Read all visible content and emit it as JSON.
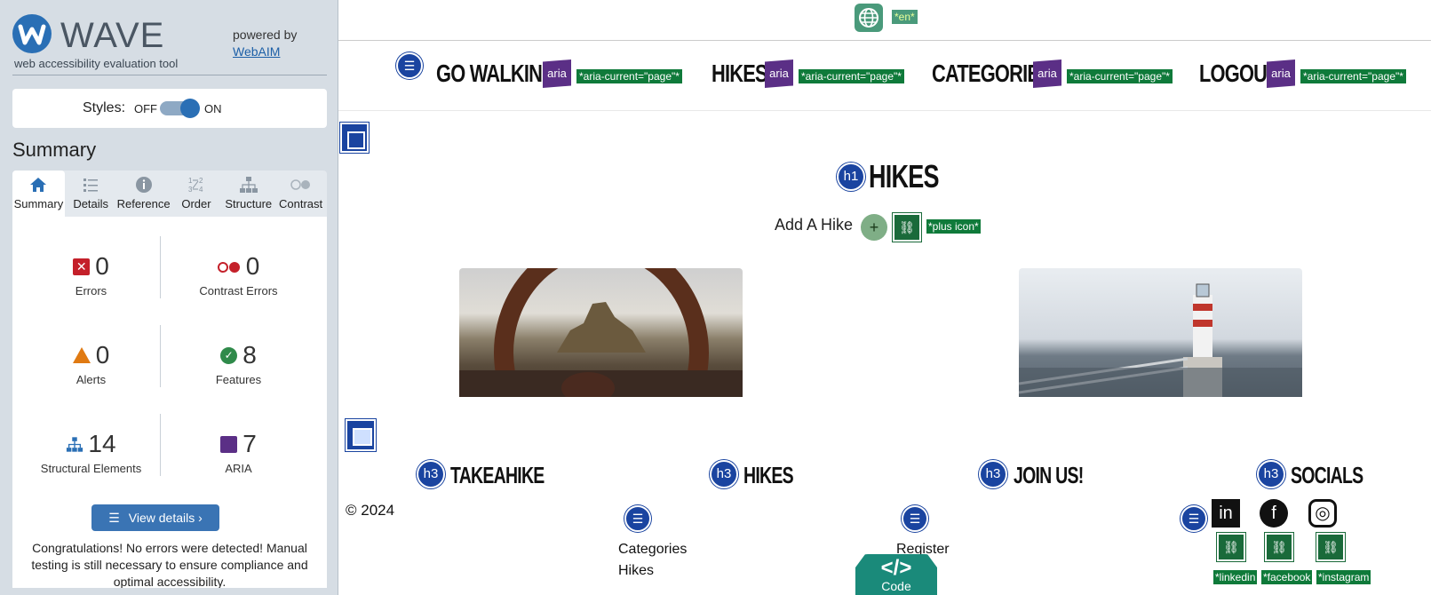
{
  "wave": {
    "logo_text": "WAVE",
    "tagline": "web accessibility evaluation tool",
    "powered_by": "powered by",
    "webaim_link": "WebAIM",
    "styles_label": "Styles:",
    "off_label": "OFF",
    "on_label": "ON",
    "summary_heading": "Summary",
    "tabs": [
      {
        "label": "Summary",
        "icon": "home-icon",
        "active": true
      },
      {
        "label": "Details",
        "icon": "list-icon",
        "active": false
      },
      {
        "label": "Reference",
        "icon": "info-icon",
        "active": false
      },
      {
        "label": "Order",
        "icon": "order-icon",
        "active": false
      },
      {
        "label": "Structure",
        "icon": "structure-icon",
        "active": false
      },
      {
        "label": "Contrast",
        "icon": "contrast-icon",
        "active": false
      }
    ],
    "stats": {
      "errors": {
        "value": "0",
        "label": "Errors"
      },
      "contrast_errors": {
        "value": "0",
        "label": "Contrast Errors"
      },
      "alerts": {
        "value": "0",
        "label": "Alerts"
      },
      "features": {
        "value": "8",
        "label": "Features"
      },
      "structural": {
        "value": "14",
        "label": "Structural Elements"
      },
      "aria": {
        "value": "7",
        "label": "ARIA"
      }
    },
    "view_details": "View details ›",
    "congrats": "Congratulations! No errors were detected! Manual testing is still necessary to ensure compliance and optimal accessibility."
  },
  "page": {
    "lang_tag": "*en*",
    "nav": [
      {
        "label": "GO WALKING!",
        "aria_tag": "*aria-current=\"page\"*"
      },
      {
        "label": "HIKES",
        "aria_tag": "*aria-current=\"page\"*"
      },
      {
        "label": "CATEGORIES",
        "aria_tag": "*aria-current=\"page\"*"
      },
      {
        "label": "LOGOUT",
        "aria_tag": "*aria-current=\"page\"*"
      }
    ],
    "aria_icon_text": "aria",
    "h1_icon": "h1",
    "h1": "HIKES",
    "add_hike": "Add A Hike",
    "plus": "+",
    "plus_icon_alt": "*plus icon*",
    "footer": {
      "h3_icon": "h3",
      "col1_heading": "TAKEAHIKE",
      "col2_heading": "HIKES",
      "col3_heading": "JOIN US!",
      "col4_heading": "SOCIALS",
      "copyright": "© 2024",
      "links_col2": [
        "Categories",
        "Hikes"
      ],
      "links_col3": [
        "Register"
      ],
      "social_alts": [
        "*linkedin",
        "*facebook",
        "*instagram"
      ],
      "code_label": "Code",
      "code_symbol": "</>"
    }
  },
  "colors": {
    "aria_purple": "#5b2f86",
    "structure_blue": "#1a44a0",
    "alt_green": "#0f7a3a",
    "wave_blue": "#2a6fb5"
  }
}
